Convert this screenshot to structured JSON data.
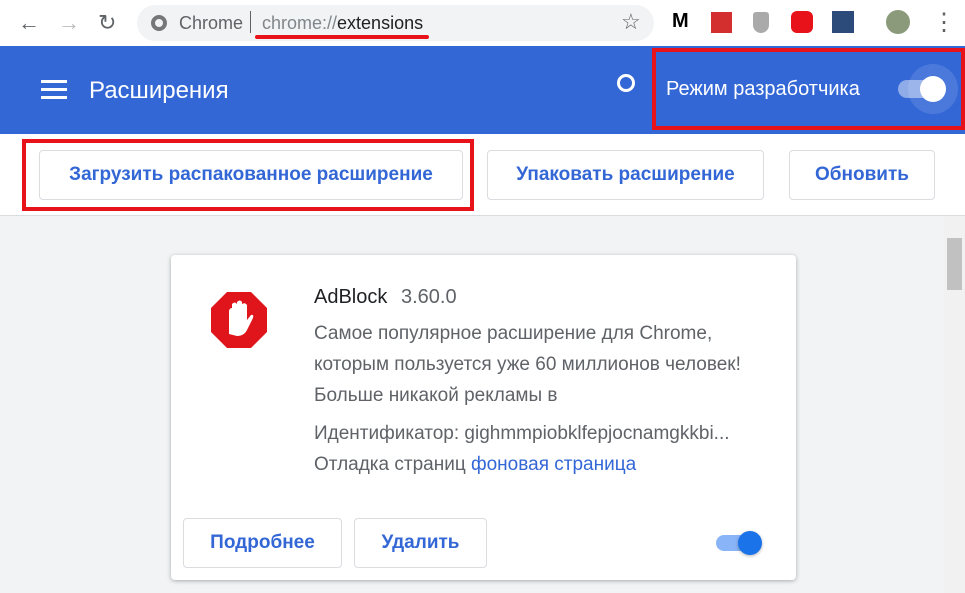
{
  "browser": {
    "back": "←",
    "forward": "→",
    "reload": "↻",
    "site_label": "Chrome",
    "url_prefix": "chrome://",
    "url_path": "extensions",
    "star": "☆",
    "menu": "⋮"
  },
  "header": {
    "title": "Расширения",
    "dev_mode_label": "Режим разработчика",
    "dev_mode_on": true
  },
  "toolbar": {
    "load_unpacked": "Загрузить распакованное расширение",
    "pack": "Упаковать расширение",
    "update": "Обновить"
  },
  "extension": {
    "name": "AdBlock",
    "version": "3.60.0",
    "description": "Самое популярное расширение для Chrome, которым пользуется уже 60 миллионов человек! Больше никакой рекламы в",
    "id": "Идентификатор: gighmmpiobklfepjocnamgkkbi...",
    "inspect_label": "Отладка страниц",
    "inspect_link": "фоновая страница",
    "details": "Подробнее",
    "remove": "Удалить",
    "enabled": true
  },
  "colors": {
    "accent": "#3367d6",
    "highlight": "#e8121a"
  }
}
